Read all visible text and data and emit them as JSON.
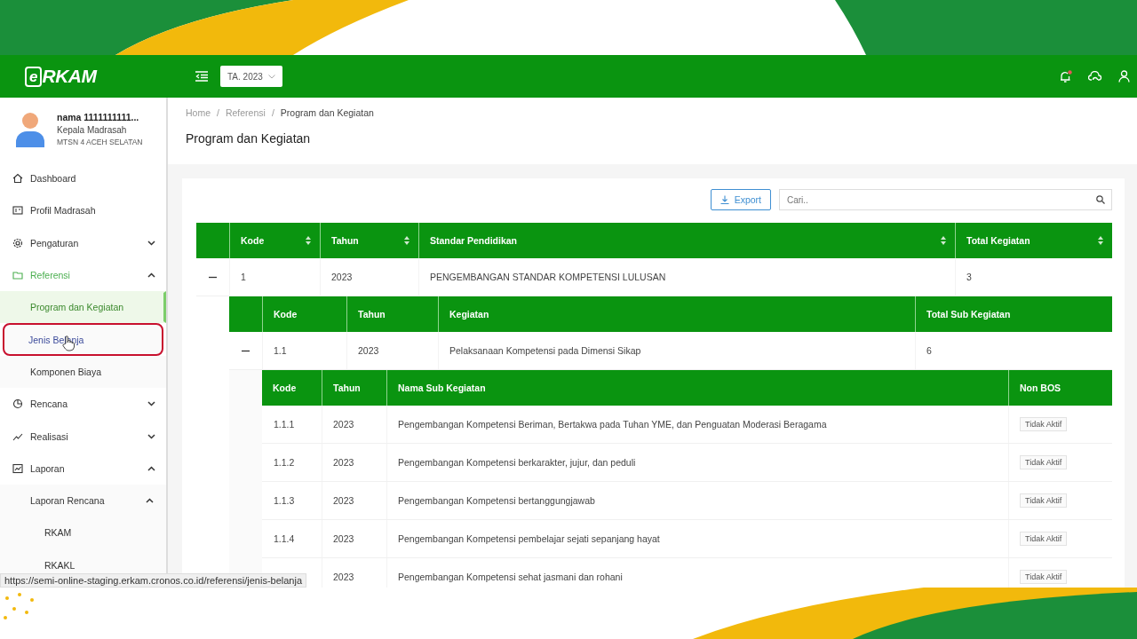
{
  "header": {
    "logo_mark": "e",
    "logo_text": "RKAM",
    "year_select": "TA. 2023"
  },
  "user": {
    "name": "nama 1111111111...",
    "role": "Kepala Madrasah",
    "school": "MTSN 4 ACEH SELATAN"
  },
  "sidebar": {
    "items": [
      {
        "label": "Dashboard",
        "active": false
      },
      {
        "label": "Profil Madrasah",
        "active": false
      },
      {
        "label": "Pengaturan",
        "active": false,
        "expanded": false
      },
      {
        "label": "Referensi",
        "active": true,
        "expanded": true,
        "children": [
          {
            "label": "Program dan Kegiatan",
            "selected": true,
            "highlighted": false
          },
          {
            "label": "Jenis Belanja",
            "selected": false,
            "highlighted": true
          },
          {
            "label": "Komponen Biaya",
            "selected": false,
            "highlighted": false
          }
        ]
      },
      {
        "label": "Rencana",
        "active": false,
        "expanded": false
      },
      {
        "label": "Realisasi",
        "active": false,
        "expanded": false
      },
      {
        "label": "Laporan",
        "active": false,
        "expanded": true,
        "children": [
          {
            "label": "Laporan Rencana",
            "selected": false,
            "highlighted": false,
            "expanded": true,
            "children": [
              {
                "label": "RKAM"
              },
              {
                "label": "RKAKL"
              }
            ]
          }
        ]
      }
    ]
  },
  "breadcrumb": {
    "separator": "/",
    "items": [
      "Home",
      "Referensi",
      "Program dan Kegiatan"
    ]
  },
  "page_title": "Program dan Kegiatan",
  "toolbar": {
    "export_button": "Export",
    "search": {
      "placeholder": "Cari.."
    }
  },
  "table": {
    "columns": [
      {
        "label": "Kode",
        "sortable": true
      },
      {
        "label": "Tahun",
        "sortable": true
      },
      {
        "label": "Standar Pendidikan",
        "sortable": true
      },
      {
        "label": "Total Kegiatan",
        "sortable": true
      }
    ],
    "rows": [
      {
        "kode": "1",
        "tahun": "2023",
        "name": "PENGEMBANGAN STANDAR KOMPETENSI LULUSAN",
        "total": "3",
        "expanded": true,
        "sub_table": {
          "columns": [
            {
              "label": "Kode",
              "sortable": false
            },
            {
              "label": "Tahun",
              "sortable": false
            },
            {
              "label": "Kegiatan",
              "sortable": false
            },
            {
              "label": "Total Sub Kegiatan",
              "sortable": false
            }
          ],
          "rows": [
            {
              "kode": "1.1",
              "tahun": "2023",
              "name": "Pelaksanaan Kompetensi pada Dimensi Sikap",
              "total": "6",
              "expanded": true,
              "sub_table": {
                "columns": [
                  {
                    "label": "Kode"
                  },
                  {
                    "label": "Tahun"
                  },
                  {
                    "label": "Nama Sub Kegiatan"
                  },
                  {
                    "label": "Non BOS"
                  }
                ],
                "rows": [
                  {
                    "kode": "1.1.1",
                    "tahun": "2023",
                    "name": "Pengembangan Kompetensi Beriman, Bertakwa pada Tuhan YME, dan Penguatan Moderasi Beragama",
                    "non_bos": "Tidak Aktif"
                  },
                  {
                    "kode": "1.1.2",
                    "tahun": "2023",
                    "name": "Pengembangan Kompetensi berkarakter, jujur, dan peduli",
                    "non_bos": "Tidak Aktif"
                  },
                  {
                    "kode": "1.1.3",
                    "tahun": "2023",
                    "name": "Pengembangan Kompetensi bertanggungjawab",
                    "non_bos": "Tidak Aktif"
                  },
                  {
                    "kode": "1.1.4",
                    "tahun": "2023",
                    "name": "Pengembangan Kompetensi pembelajar sejati sepanjang hayat",
                    "non_bos": "Tidak Aktif"
                  },
                  {
                    "tahun": "2023",
                    "name": "Pengembangan Kompetensi sehat jasmani dan rohani",
                    "non_bos": "Tidak Aktif"
                  }
                ]
              }
            }
          ]
        }
      }
    ]
  },
  "status_url": "https://semi-online-staging.erkam.cronos.co.id/referensi/jenis-belanja"
}
